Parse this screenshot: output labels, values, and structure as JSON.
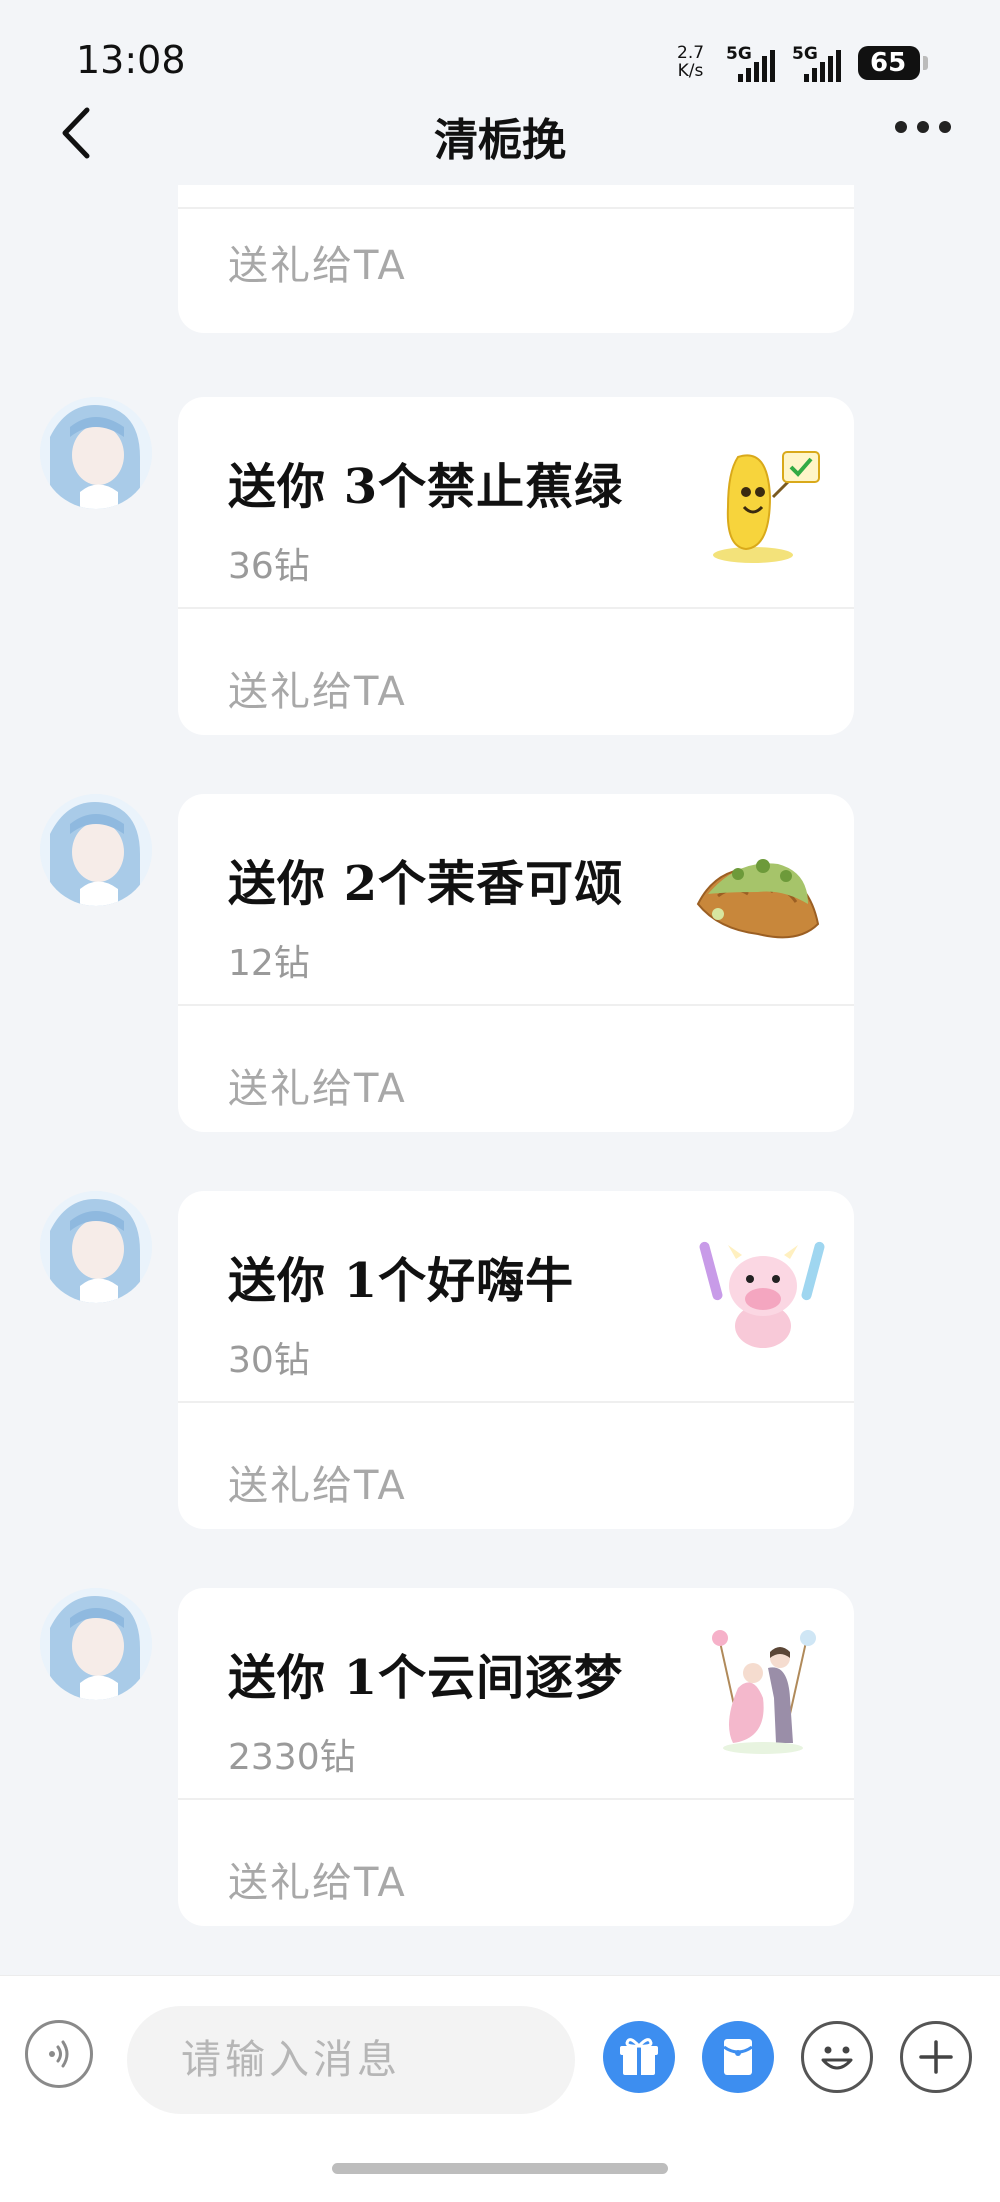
{
  "status_bar": {
    "time": "13:08",
    "network_speed_value": "2.7",
    "network_speed_unit": "K/s",
    "signal_1": "5G",
    "signal_2": "5G",
    "battery": "65"
  },
  "header": {
    "title": "清栀挽",
    "back_icon": "chevron-left-icon",
    "more_icon": "more-horizontal-icon"
  },
  "gift_cards": [
    {
      "send_label": "送礼给TA"
    },
    {
      "message": "送你 3个禁止蕉绿",
      "price": "36钻",
      "send_label": "送礼给TA",
      "gift_icon": "banana-mascot"
    },
    {
      "message": "送你 2个茉香可颂",
      "price": "12钻",
      "send_label": "送礼给TA",
      "gift_icon": "matcha-croissant"
    },
    {
      "message": "送你 1个好嗨牛",
      "price": "30钻",
      "send_label": "送礼给TA",
      "gift_icon": "pink-cow-with-glowsticks"
    },
    {
      "message": "送你 1个云间逐梦",
      "price": "2330钻",
      "send_label": "送礼给TA",
      "gift_icon": "couple-on-swing"
    }
  ],
  "input_bar": {
    "placeholder": "请输入消息",
    "voice_icon": "voice-icon",
    "gift_icon": "gift-icon",
    "red_packet_icon": "red-packet-icon",
    "emoji_icon": "emoji-icon",
    "plus_icon": "plus-icon"
  },
  "colors": {
    "background": "#f3f5f8",
    "accent_blue": "#3d8ef0",
    "card": "#ffffff",
    "muted_text": "#a8a8a8"
  }
}
